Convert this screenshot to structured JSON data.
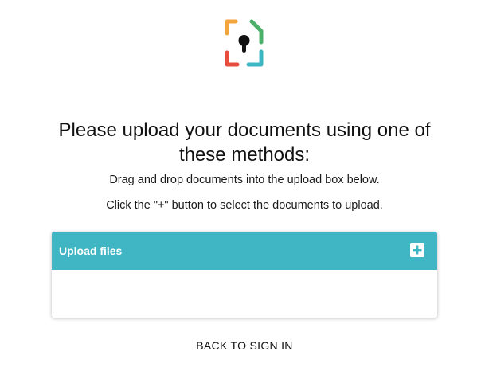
{
  "logo": {
    "icon": "keyhole-document-logo",
    "colors": [
      "#f4a63c",
      "#4caf6a",
      "#e84c3d",
      "#3bb6c3",
      "#111111"
    ]
  },
  "heading": {
    "title": "Please upload your documents using one of these methods:"
  },
  "instructions": {
    "drag_drop": "Drag and drop documents into the upload box below.",
    "click_plus": "Click the \"+\" button to select the documents to upload."
  },
  "upload": {
    "header_label": "Upload files",
    "add_icon": "plus-icon",
    "header_color": "#40b6c4"
  },
  "footer": {
    "back_label": "BACK TO SIGN IN"
  }
}
